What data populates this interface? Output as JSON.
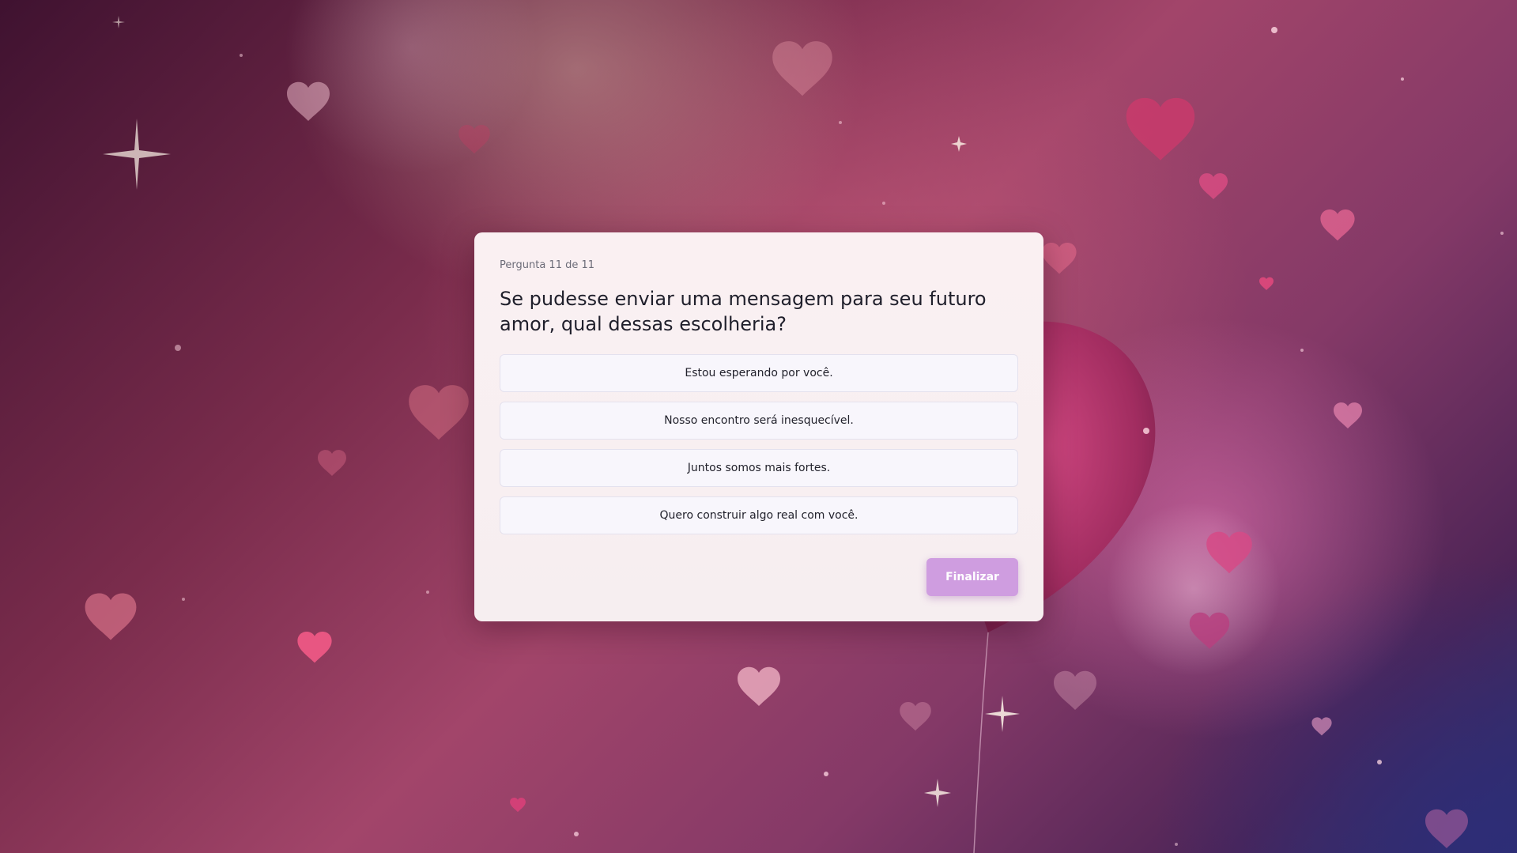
{
  "quiz": {
    "progress": "Pergunta 11 de 11",
    "question": "Se pudesse enviar uma mensagem para seu futuro amor, qual dessas escolheria?",
    "options": [
      "Estou esperando por você.",
      "Nosso encontro será inesquecível.",
      "Juntos somos mais fortes.",
      "Quero construir algo real com você."
    ],
    "finish_label": "Finalizar"
  },
  "theme": {
    "card_background": "#faf0f2",
    "button_color": "#cf9de0",
    "option_background": "#f8f6fc"
  },
  "background": {
    "icons": [
      "heart-icon",
      "sparkle-icon",
      "heart-balloon-icon"
    ]
  }
}
